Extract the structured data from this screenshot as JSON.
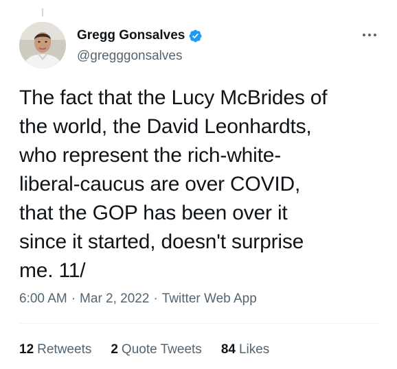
{
  "author": {
    "display_name": "Gregg Gonsalves",
    "handle": "@gregggonsalves",
    "verified": true,
    "avatar_icon": "person-avatar",
    "verified_icon": "verified-badge-icon",
    "verified_color": "#1d9bf0"
  },
  "more_icon": "more-options-icon",
  "tweet": {
    "lines": [
      "The fact that the Lucy McBrides of",
      "the world, the David Leonhardts,",
      "who represent the rich-white-",
      "liberal-caucus are over COVID,",
      "that the GOP has been over it",
      "since it started, doesn't surprise",
      "me. 11/"
    ]
  },
  "meta": {
    "time": "6:00 AM",
    "separator": "·",
    "date": "Mar 2, 2022",
    "source": "Twitter Web App"
  },
  "stats": {
    "retweets_count": "12",
    "retweets_label": "Retweets",
    "quotes_count": "2",
    "quotes_label": "Quote Tweets",
    "likes_count": "84",
    "likes_label": "Likes"
  }
}
